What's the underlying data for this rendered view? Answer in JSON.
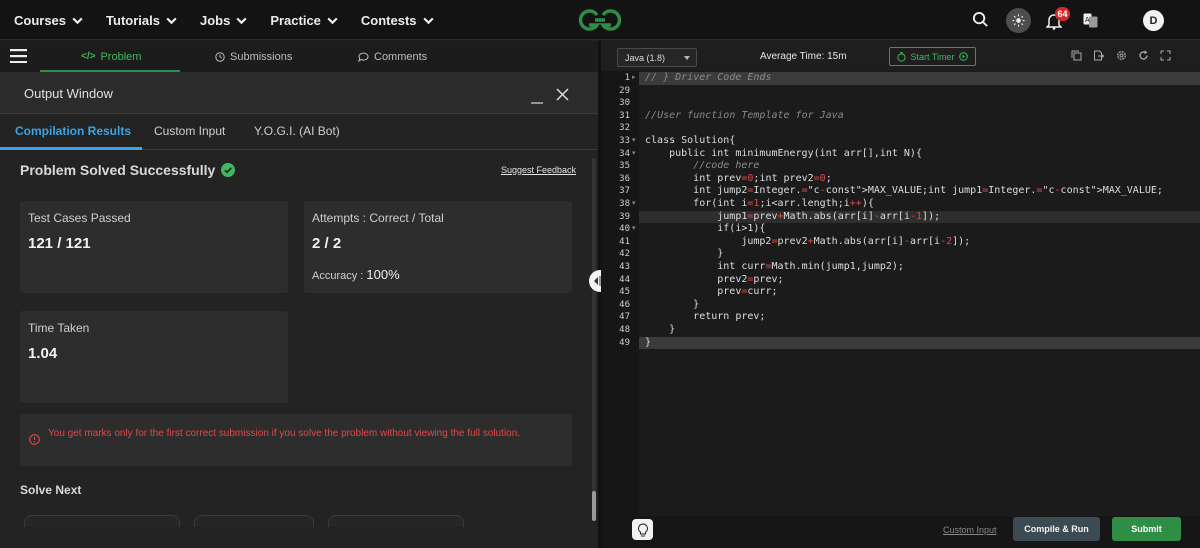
{
  "nav": {
    "items": [
      {
        "label": "Courses"
      },
      {
        "label": "Tutorials"
      },
      {
        "label": "Jobs"
      },
      {
        "label": "Practice"
      },
      {
        "label": "Contests"
      }
    ],
    "logo_icon": "gfg-logo-icon",
    "notification_count": "64",
    "avatar_letter": "D",
    "brand_color": "#2f8d46"
  },
  "left_tabs": [
    {
      "label": "Problem",
      "icon": "code-icon",
      "active": true
    },
    {
      "label": "Submissions",
      "icon": "clock-icon",
      "active": false
    },
    {
      "label": "Comments",
      "icon": "comment-icon",
      "active": false
    }
  ],
  "output": {
    "title": "Output Window",
    "subtabs": [
      {
        "label": "Compilation Results",
        "active": true
      },
      {
        "label": "Custom Input",
        "active": false
      },
      {
        "label": "Y.O.G.I. (AI Bot)",
        "active": false
      }
    ],
    "status": "Problem Solved Successfully",
    "suggest_feedback": "Suggest Feedback",
    "test_cases": {
      "label": "Test Cases Passed",
      "value": "121 / 121"
    },
    "attempts": {
      "label": "Attempts : Correct / Total",
      "value": "2 / 2",
      "accuracy_label": "Accuracy :",
      "accuracy_value": "100%"
    },
    "time_taken": {
      "label": "Time Taken",
      "value": "1.04"
    },
    "warning": "You get marks only for the first correct submission if you solve the problem without viewing the full solution.",
    "solve_next": "Solve Next"
  },
  "editor": {
    "language": "Java (1.8)",
    "average_time": "Average Time: 15m",
    "start_timer": "Start Timer",
    "custom_input": "Custom Input",
    "compile_run": "Compile & Run",
    "submit": "Submit",
    "line_numbers": [
      "1",
      "29",
      "30",
      "31",
      "32",
      "33",
      "34",
      "35",
      "36",
      "37",
      "38",
      "39",
      "40",
      "41",
      "42",
      "43",
      "44",
      "45",
      "46",
      "47",
      "48",
      "49"
    ],
    "code_lines": [
      "// } Driver Code Ends",
      "",
      "",
      "//User function Template for Java",
      "",
      "class Solution{",
      "    public int minimumEnergy(int arr[],int N){",
      "        //code here",
      "        int prev=0;int prev2=0;",
      "        int jump2=Integer.MAX_VALUE;int jump1=Integer.MAX_VALUE;",
      "        for(int i=1;i<arr.length;i++){",
      "            jump1=prev+Math.abs(arr[i]-arr[i-1]);",
      "            if(i>1){",
      "                jump2=prev2+Math.abs(arr[i]-arr[i-2]);",
      "            }",
      "            int curr=Math.min(jump1,jump2);",
      "            prev2=prev;",
      "            prev=curr;",
      "        }",
      "        return prev;",
      "    }",
      "}"
    ]
  }
}
